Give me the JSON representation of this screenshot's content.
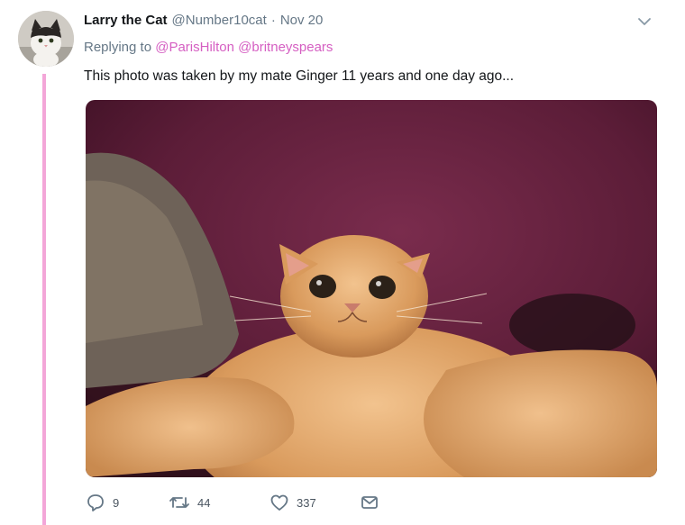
{
  "author": {
    "name": "Larry the Cat",
    "handle": "@Number10cat",
    "separator": "·",
    "date": "Nov 20"
  },
  "replying": {
    "prefix": "Replying to ",
    "mentions": [
      "@ParisHilton",
      "@britneyspears"
    ]
  },
  "tweet_text": "This photo was taken by my mate Ginger 11 years and one day ago...",
  "actions": {
    "reply_count": "9",
    "retweet_count": "44",
    "like_count": "337"
  },
  "colors": {
    "thread_line": "#f3a6d8",
    "mention": "#d55fc2",
    "muted": "#657786"
  },
  "icons": [
    "chevron-down-icon",
    "reply-icon",
    "retweet-icon",
    "like-icon",
    "direct-message-icon"
  ]
}
